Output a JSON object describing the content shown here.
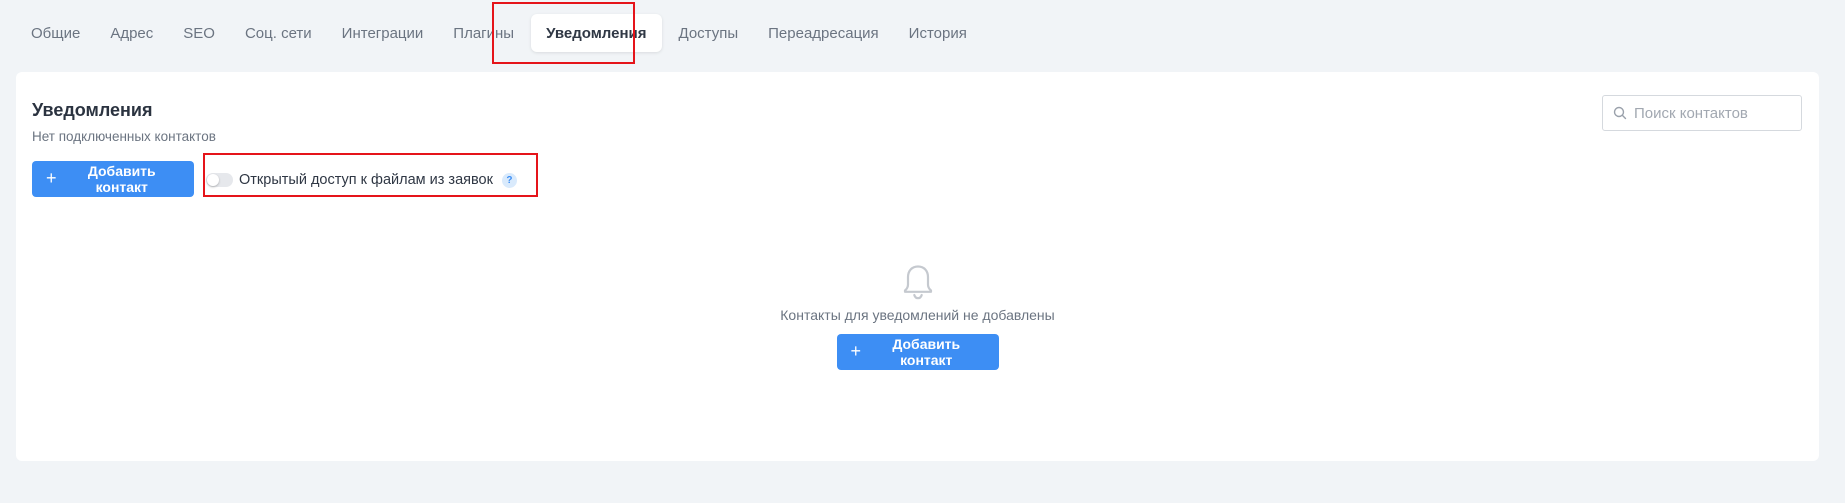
{
  "tabs": [
    {
      "label": "Общие",
      "active": false
    },
    {
      "label": "Адрес",
      "active": false
    },
    {
      "label": "SEO",
      "active": false
    },
    {
      "label": "Соц. сети",
      "active": false
    },
    {
      "label": "Интеграции",
      "active": false
    },
    {
      "label": "Плагины",
      "active": false
    },
    {
      "label": "Уведомления",
      "active": true
    },
    {
      "label": "Доступы",
      "active": false
    },
    {
      "label": "Переадресация",
      "active": false
    },
    {
      "label": "История",
      "active": false
    }
  ],
  "card": {
    "title": "Уведомления",
    "subtitle": "Нет подключенных контактов",
    "add_button_label": "Добавить контакт",
    "toggle": {
      "label": "Открытый доступ к файлам из заявок",
      "on": false,
      "help_glyph": "?"
    },
    "search": {
      "placeholder": "Поиск контактов",
      "value": ""
    }
  },
  "empty_state": {
    "icon": "bell-icon",
    "text": "Контакты для уведомлений не добавлены",
    "button_label": "Добавить контакт"
  },
  "colors": {
    "accent": "#3d8ef4",
    "page_bg": "#f1f4f7",
    "highlight": "#e5141a"
  },
  "icons": {
    "add": "plus-icon",
    "search": "search-icon",
    "help": "question-icon"
  }
}
